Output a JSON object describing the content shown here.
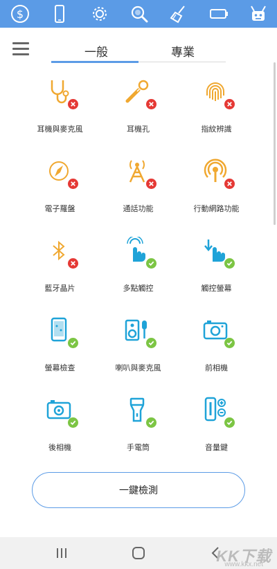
{
  "topbar": {
    "icons": [
      "dollar-icon",
      "phone-icon",
      "gear-icon",
      "search-icon",
      "broom-icon",
      "battery-icon",
      "robot-icon"
    ],
    "color": "#5b9be6"
  },
  "tabs": [
    {
      "label": "一般",
      "active": true
    },
    {
      "label": "專業",
      "active": false
    }
  ],
  "items": [
    {
      "label": "耳機與麥克風",
      "icon": "stethoscope-icon",
      "status": "fail",
      "color": "#f0a830"
    },
    {
      "label": "耳機孔",
      "icon": "headphone-jack-icon",
      "status": "fail",
      "color": "#f0a830"
    },
    {
      "label": "指紋辨識",
      "icon": "fingerprint-icon",
      "status": "fail",
      "color": "#f0a830"
    },
    {
      "label": "電子羅盤",
      "icon": "compass-icon",
      "status": "fail",
      "color": "#f0a830"
    },
    {
      "label": "通話功能",
      "icon": "cell-tower-icon",
      "status": "fail",
      "color": "#f0a830"
    },
    {
      "label": "行動網路功能",
      "icon": "mobile-network-icon",
      "status": "fail",
      "color": "#f0a830"
    },
    {
      "label": "藍牙晶片",
      "icon": "bluetooth-icon",
      "status": "fail",
      "color": "#f0a830"
    },
    {
      "label": "多點觸控",
      "icon": "multitouch-icon",
      "status": "ok",
      "color": "#1fa3d8"
    },
    {
      "label": "觸控螢幕",
      "icon": "touchscreen-icon",
      "status": "ok",
      "color": "#1fa3d8"
    },
    {
      "label": "螢幕檢查",
      "icon": "screen-check-icon",
      "status": "ok",
      "color": "#1fa3d8"
    },
    {
      "label": "喇叭與麥克風",
      "icon": "speaker-mic-icon",
      "status": "ok",
      "color": "#1fa3d8"
    },
    {
      "label": "前相機",
      "icon": "front-camera-icon",
      "status": "ok",
      "color": "#1fa3d8"
    },
    {
      "label": "後相機",
      "icon": "rear-camera-icon",
      "status": "ok",
      "color": "#1fa3d8"
    },
    {
      "label": "手電筒",
      "icon": "flashlight-icon",
      "status": "ok",
      "color": "#1fa3d8"
    },
    {
      "label": "音量鍵",
      "icon": "volume-keys-icon",
      "status": "ok",
      "color": "#1fa3d8"
    }
  ],
  "action": {
    "label": "一鍵檢測"
  },
  "status_colors": {
    "fail": "#e53935",
    "ok": "#7cc544"
  },
  "watermark": {
    "logo": "KK下载",
    "url": "www.kkx.net"
  }
}
